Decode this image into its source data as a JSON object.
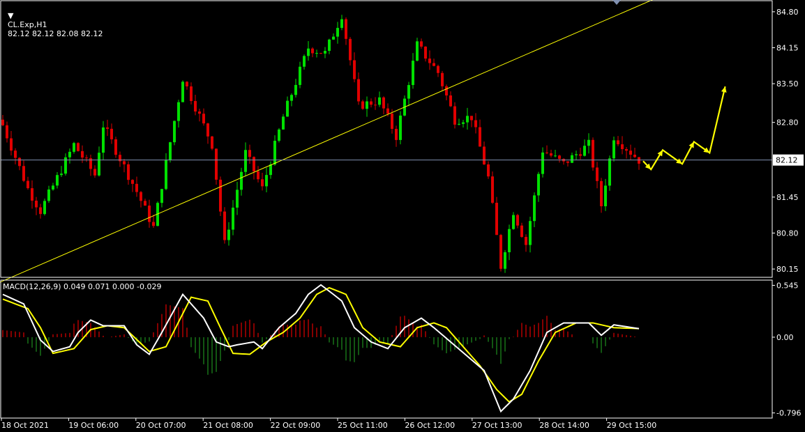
{
  "header": {
    "symbol": "CL.Exp,H1",
    "ohlc": "82.12 82.12 82.08 82.12"
  },
  "macd_panel": {
    "label": "MACD(12,26,9) 0.049 0.071 0.000 -0.029"
  },
  "colors": {
    "background": "#000000",
    "bull": "#00e000",
    "bear": "#e00000",
    "grid_border": "#ffffff",
    "trendline": "#ffff00",
    "price_line": "#8090b0",
    "macd_main": "#ffffff",
    "macd_signal": "#ffff00"
  },
  "chart_data": [
    {
      "type": "candlestick",
      "current_price": "82.12",
      "y_ticks": [
        "84.80",
        "84.15",
        "83.50",
        "82.80",
        "81.45",
        "80.80",
        "80.15"
      ],
      "ylim": [
        80.0,
        85.0
      ],
      "x_ticks": [
        "18 Oct 2021",
        "19 Oct 06:00",
        "20 Oct 07:00",
        "21 Oct 08:00",
        "22 Oct 09:00",
        "25 Oct 11:00",
        "26 Oct 12:00",
        "27 Oct 13:00",
        "28 Oct 14:00",
        "29 Oct 15:00"
      ],
      "bars": 153,
      "key_closes": [
        [
          0,
          82.75
        ],
        [
          6,
          81.6
        ],
        [
          9,
          81.2
        ],
        [
          17,
          82.4
        ],
        [
          22,
          81.85
        ],
        [
          24,
          82.75
        ],
        [
          32,
          81.55
        ],
        [
          36,
          80.9
        ],
        [
          43,
          83.6
        ],
        [
          50,
          82.4
        ],
        [
          53,
          80.6
        ],
        [
          58,
          82.25
        ],
        [
          62,
          81.6
        ],
        [
          67,
          82.9
        ],
        [
          73,
          84.15
        ],
        [
          77,
          84.05
        ],
        [
          81,
          84.75
        ],
        [
          85,
          83.1
        ],
        [
          90,
          83.2
        ],
        [
          94,
          82.55
        ],
        [
          99,
          84.2
        ],
        [
          104,
          83.7
        ],
        [
          108,
          82.85
        ],
        [
          112,
          82.9
        ],
        [
          116,
          81.8
        ],
        [
          119,
          80.2
        ],
        [
          122,
          81.2
        ],
        [
          125,
          80.6
        ],
        [
          129,
          82.3
        ],
        [
          134,
          82.05
        ],
        [
          140,
          82.4
        ],
        [
          143,
          81.3
        ],
        [
          146,
          82.55
        ],
        [
          152,
          82.12
        ]
      ],
      "trendline": {
        "start": [
          -5,
          79.77
        ],
        "end": [
          170,
          85.5
        ]
      },
      "forecast_arrows": [
        [
          0,
          82.1
        ],
        [
          2,
          81.95
        ],
        [
          5,
          82.3
        ],
        [
          10,
          82.05
        ],
        [
          13,
          82.45
        ],
        [
          17,
          82.25
        ],
        [
          21,
          83.45
        ]
      ]
    },
    {
      "type": "line",
      "title": "MACD(12,26,9) 0.049 0.071 0.000 -0.029",
      "y_ticks": [
        "0.545",
        "0.00",
        "-0.796"
      ],
      "ylim": [
        -0.85,
        0.6
      ],
      "series": [
        {
          "key": "main",
          "points": [
            [
              0,
              0.45
            ],
            [
              5,
              0.35
            ],
            [
              9,
              -0.03
            ],
            [
              12,
              -0.15
            ],
            [
              16,
              -0.1
            ],
            [
              18,
              0.05
            ],
            [
              21,
              0.18
            ],
            [
              24,
              0.12
            ],
            [
              29,
              0.12
            ],
            [
              32,
              -0.08
            ],
            [
              35,
              -0.18
            ],
            [
              38,
              0.05
            ],
            [
              43,
              0.45
            ],
            [
              48,
              0.2
            ],
            [
              51,
              -0.05
            ],
            [
              54,
              -0.1
            ],
            [
              56,
              -0.08
            ],
            [
              60,
              -0.05
            ],
            [
              62,
              -0.12
            ],
            [
              66,
              0.1
            ],
            [
              70,
              0.25
            ],
            [
              73,
              0.45
            ],
            [
              76,
              0.55
            ],
            [
              79,
              0.45
            ],
            [
              81,
              0.38
            ],
            [
              84,
              0.1
            ],
            [
              88,
              -0.05
            ],
            [
              92,
              -0.12
            ],
            [
              96,
              0.1
            ],
            [
              100,
              0.2
            ],
            [
              103,
              0.1
            ],
            [
              107,
              -0.05
            ],
            [
              111,
              -0.2
            ],
            [
              115,
              -0.35
            ],
            [
              119,
              -0.78
            ],
            [
              122,
              -0.65
            ],
            [
              126,
              -0.35
            ],
            [
              130,
              0.05
            ],
            [
              134,
              0.15
            ],
            [
              140,
              0.15
            ],
            [
              143,
              0.02
            ],
            [
              146,
              0.13
            ],
            [
              152,
              0.09
            ]
          ]
        },
        {
          "key": "signal",
          "points": [
            [
              0,
              0.4
            ],
            [
              6,
              0.3
            ],
            [
              9,
              0.1
            ],
            [
              12,
              -0.17
            ],
            [
              17,
              -0.12
            ],
            [
              21,
              0.08
            ],
            [
              25,
              0.12
            ],
            [
              29,
              0.1
            ],
            [
              35,
              -0.15
            ],
            [
              39,
              -0.1
            ],
            [
              45,
              0.42
            ],
            [
              49,
              0.38
            ],
            [
              52,
              0.1
            ],
            [
              55,
              -0.17
            ],
            [
              59,
              -0.18
            ],
            [
              63,
              -0.05
            ],
            [
              67,
              0.05
            ],
            [
              71,
              0.2
            ],
            [
              75,
              0.45
            ],
            [
              78,
              0.52
            ],
            [
              82,
              0.45
            ],
            [
              86,
              0.1
            ],
            [
              90,
              -0.05
            ],
            [
              95,
              -0.1
            ],
            [
              99,
              0.1
            ],
            [
              103,
              0.15
            ],
            [
              106,
              0.1
            ],
            [
              110,
              -0.1
            ],
            [
              114,
              -0.3
            ],
            [
              118,
              -0.55
            ],
            [
              121,
              -0.68
            ],
            [
              124,
              -0.6
            ],
            [
              128,
              -0.25
            ],
            [
              132,
              0.05
            ],
            [
              137,
              0.15
            ],
            [
              141,
              0.15
            ],
            [
              146,
              0.1
            ],
            [
              152,
              0.09
            ]
          ]
        }
      ]
    }
  ]
}
